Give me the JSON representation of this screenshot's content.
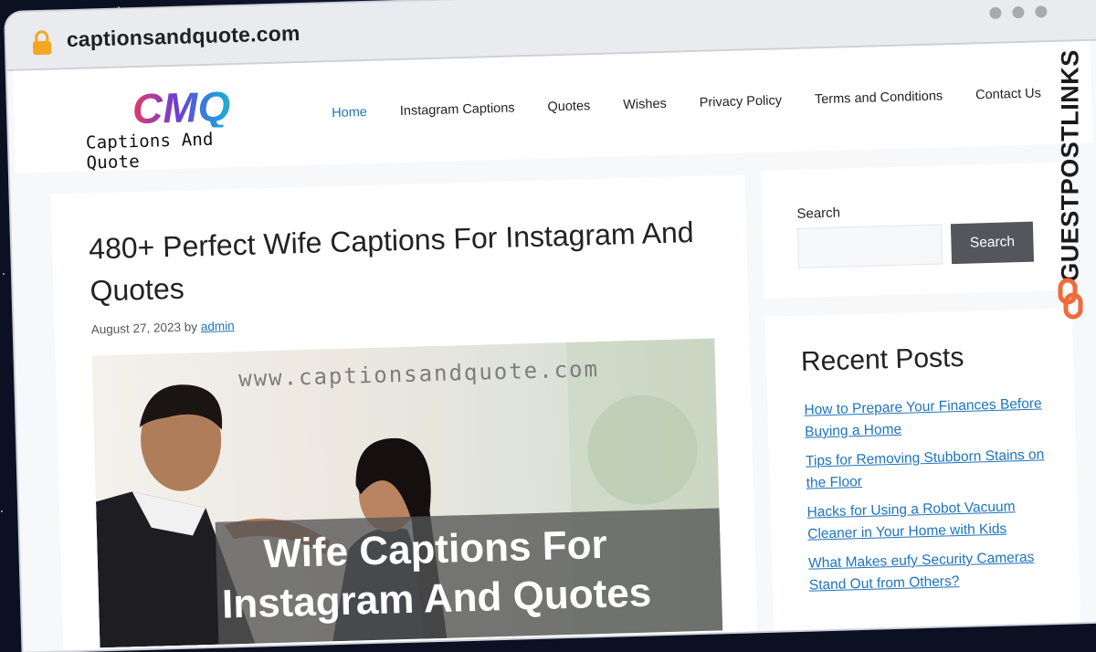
{
  "browser": {
    "url": "captionsandquote.com"
  },
  "site": {
    "logo_mark": "CMQ",
    "logo_text": "Captions And Quote"
  },
  "nav": {
    "items": [
      {
        "label": "Home",
        "active": true
      },
      {
        "label": "Instagram Captions",
        "active": false
      },
      {
        "label": "Quotes",
        "active": false
      },
      {
        "label": "Wishes",
        "active": false
      },
      {
        "label": "Privacy Policy",
        "active": false
      },
      {
        "label": "Terms and Conditions",
        "active": false
      },
      {
        "label": "Contact Us",
        "active": false
      }
    ]
  },
  "post": {
    "title": "480+ Perfect Wife Captions For Instagram And Quotes",
    "date": "August 27, 2023",
    "by": "by",
    "author": "admin",
    "image": {
      "watermark": "www.captionsandquote.com",
      "banner_text": "Wife Captions For Instagram And Quotes"
    }
  },
  "sidebar": {
    "search_label": "Search",
    "search_button": "Search",
    "recent_title": "Recent Posts",
    "recent_posts": [
      "How to Prepare Your Finances Before Buying a Home",
      "Tips for Removing Stubborn Stains on the Floor",
      "Hacks for Using a Robot Vacuum Cleaner in Your Home with Kids",
      "What Makes eufy Security Cameras Stand Out from Others?"
    ]
  },
  "badge": {
    "text": "GUESTPOSTLINKS"
  },
  "colors": {
    "link": "#1e73be",
    "button": "#55555e",
    "badge_accent": "#f26b3a"
  }
}
